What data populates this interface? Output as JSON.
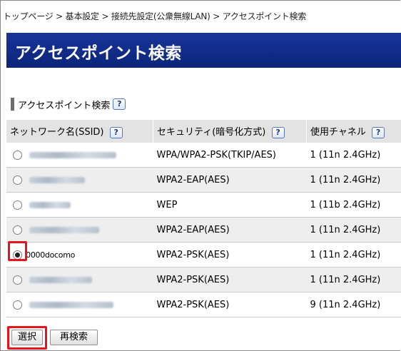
{
  "breadcrumb": "トップページ > 基本設定 > 接続先設定(公衆無線LAN) > アクセスポイント検索",
  "page_title": "アクセスポイント検索",
  "section_title": "アクセスポイント検索",
  "help_glyph": "?",
  "table": {
    "headers": [
      "ネットワーク名(SSID)",
      "セキュリティ(暗号化方式)",
      "使用チャネル"
    ],
    "rows": [
      {
        "ssid": "",
        "security": "WPA/WPA2-PSK(TKIP/AES)",
        "channel": "1 (11n 2.4GHz)",
        "selected": false
      },
      {
        "ssid": "",
        "security": "WPA2-EAP(AES)",
        "channel": "1 (11n 2.4GHz)",
        "selected": false
      },
      {
        "ssid": "",
        "security": "WEP",
        "channel": "1 (11b 2.4GHz)",
        "selected": false
      },
      {
        "ssid": "",
        "security": "WPA2-EAP(AES)",
        "channel": "1 (11n 2.4GHz)",
        "selected": false
      },
      {
        "ssid": "0000docomo",
        "security": "WPA2-PSK(AES)",
        "channel": "1 (11n 2.4GHz)",
        "selected": true
      },
      {
        "ssid": "",
        "security": "WPA2-PSK(AES)",
        "channel": "1 (11n 2.4GHz)",
        "selected": false
      },
      {
        "ssid": "",
        "security": "WPA2-PSK(AES)",
        "channel": "9 (11n 2.4GHz)",
        "selected": false
      }
    ]
  },
  "buttons": {
    "select_label": "選択",
    "research_label": "再検索"
  },
  "colors": {
    "header_bg": "#0e2a8a",
    "highlight": "#e8141b"
  }
}
